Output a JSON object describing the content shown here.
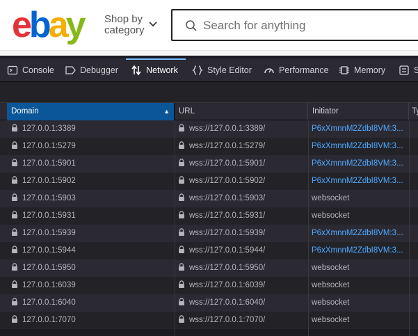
{
  "ebay": {
    "logo_letters": [
      {
        "ch": "e",
        "color": "#e53238"
      },
      {
        "ch": "b",
        "color": "#0064d2"
      },
      {
        "ch": "a",
        "color": "#f5af02"
      },
      {
        "ch": "y",
        "color": "#86b817"
      }
    ],
    "shop_by_line1": "Shop by",
    "shop_by_line2": "category",
    "search_placeholder": "Search for anything"
  },
  "devtools": {
    "tabs": [
      {
        "label": "Console",
        "icon": "console-icon"
      },
      {
        "label": "Debugger",
        "icon": "debugger-icon"
      },
      {
        "label": "Network",
        "icon": "network-icon",
        "active": true
      },
      {
        "label": "Style Editor",
        "icon": "style-editor-icon"
      },
      {
        "label": "Performance",
        "icon": "performance-icon"
      },
      {
        "label": "Memory",
        "icon": "memory-icon"
      },
      {
        "label": "S",
        "icon": "storage-icon"
      }
    ],
    "accent": "#75bfff",
    "table": {
      "headers": {
        "domain": "Domain",
        "url": "URL",
        "initiator": "Initiator",
        "type": "Ty"
      },
      "sort_arrow": "▲",
      "rows": [
        {
          "domain": "127.0.0.1:3389",
          "url": "wss://127.0.0.1:3389/",
          "initiator": "P6xXmnnM2ZdbI8VM:3...",
          "link": true
        },
        {
          "domain": "127.0.0.1:5279",
          "url": "wss://127.0.0.1:5279/",
          "initiator": "P6xXmnnM2ZdbI8VM:3...",
          "link": true
        },
        {
          "domain": "127.0.0.1:5901",
          "url": "wss://127.0.0.1:5901/",
          "initiator": "P6xXmnnM2ZdbI8VM:3...",
          "link": true
        },
        {
          "domain": "127.0.0.1:5902",
          "url": "wss://127.0.0.1:5902/",
          "initiator": "P6xXmnnM2ZdbI8VM:3...",
          "link": true
        },
        {
          "domain": "127.0.0.1:5903",
          "url": "wss://127.0.0.1:5903/",
          "initiator": "websocket",
          "link": false
        },
        {
          "domain": "127.0.0.1:5931",
          "url": "wss://127.0.0.1:5931/",
          "initiator": "websocket",
          "link": false
        },
        {
          "domain": "127.0.0.1:5939",
          "url": "wss://127.0.0.1:5939/",
          "initiator": "P6xXmnnM2ZdbI8VM:3...",
          "link": true
        },
        {
          "domain": "127.0.0.1:5944",
          "url": "wss://127.0.0.1:5944/",
          "initiator": "P6xXmnnM2ZdbI8VM:3...",
          "link": true
        },
        {
          "domain": "127.0.0.1:5950",
          "url": "wss://127.0.0.1:5950/",
          "initiator": "websocket",
          "link": false
        },
        {
          "domain": "127.0.0.1:6039",
          "url": "wss://127.0.0.1:6039/",
          "initiator": "websocket",
          "link": false
        },
        {
          "domain": "127.0.0.1:6040",
          "url": "wss://127.0.0.1:6040/",
          "initiator": "websocket",
          "link": false
        },
        {
          "domain": "127.0.0.1:7070",
          "url": "wss://127.0.0.1:7070/",
          "initiator": "websocket",
          "link": false
        }
      ]
    }
  }
}
